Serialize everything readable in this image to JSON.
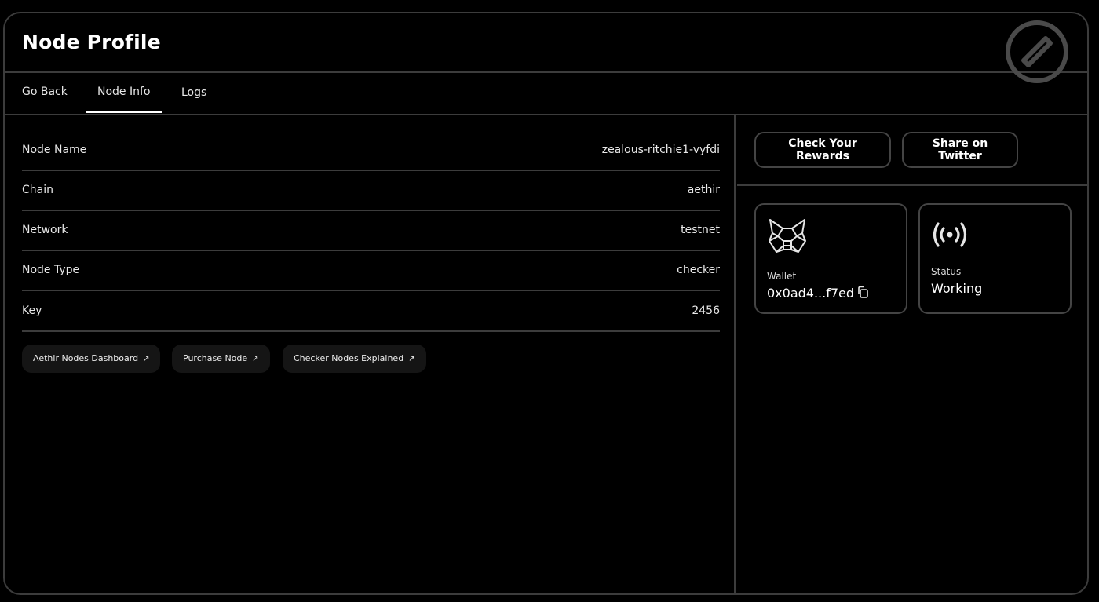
{
  "header": {
    "title": "Node Profile",
    "logo_icon": "compass-icon"
  },
  "tabs": [
    {
      "label": "Go Back"
    },
    {
      "label": "Node Info",
      "active": true
    },
    {
      "label": "Logs"
    }
  ],
  "details": [
    {
      "label": "Node Name",
      "value": "zealous-ritchie1-vyfdi"
    },
    {
      "label": "Chain",
      "value": "aethir"
    },
    {
      "label": "Network",
      "value": "testnet"
    },
    {
      "label": "Node Type",
      "value": "checker"
    },
    {
      "label": "Key",
      "value": "2456"
    }
  ],
  "links": [
    {
      "label": "Aethir Nodes Dashboard",
      "icon": "external-link-icon"
    },
    {
      "label": "Purchase Node",
      "icon": "external-link-icon"
    },
    {
      "label": "Checker Nodes Explained",
      "icon": "external-link-icon"
    }
  ],
  "actions": {
    "rewards_label": "Check Your Rewards",
    "share_label": "Share on Twitter"
  },
  "wallet": {
    "label": "Wallet",
    "address": "0x0ad4...f7ed",
    "icon": "metamask-fox-icon"
  },
  "status": {
    "label": "Status",
    "value": "Working",
    "icon": "broadcast-signal-icon"
  },
  "colors": {
    "background": "#000000",
    "border": "#3c3c3c",
    "text": "#ffffff",
    "pill_bg": "#151515"
  }
}
